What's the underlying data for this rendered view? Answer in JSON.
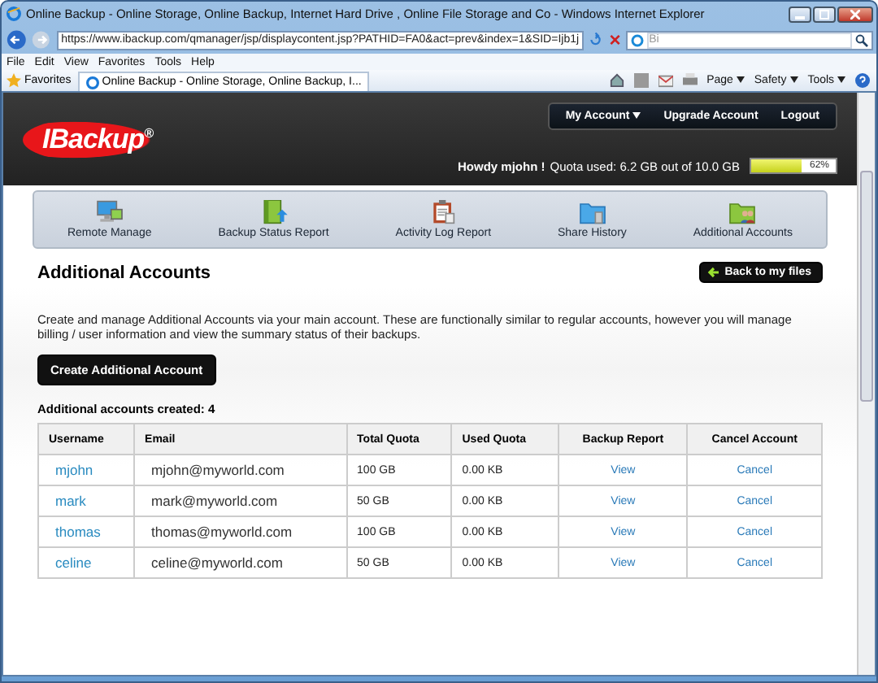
{
  "window": {
    "title": "Online Backup - Online Storage, Online Backup, Internet Hard Drive , Online File Storage and Co - Windows Internet Explorer"
  },
  "address_bar": {
    "url": "https://www.ibackup.com/qmanager/jsp/displaycontent.jsp?PATHID=FA0&act=prev&index=1&SID=Ijb1j",
    "search_placeholder": "Bi"
  },
  "menu": [
    "File",
    "Edit",
    "View",
    "Favorites",
    "Tools",
    "Help"
  ],
  "favorites_bar": {
    "label": "Favorites",
    "tab": "Online Backup - Online Storage, Online Backup, I...",
    "commands": [
      "Page",
      "Safety",
      "Tools"
    ]
  },
  "site_header": {
    "logo": "IBackup$^{®}$",
    "top_nav": [
      {
        "label": "My Account",
        "dropdown": true
      },
      {
        "label": "Upgrade Account",
        "dropdown": false
      },
      {
        "label": "Logout",
        "dropdown": false
      }
    ],
    "greeting": "Howdy mjohn !",
    "quota_text": "Quota used: 6.2 GB out of 10.0 GB",
    "quota": {
      "level": 0.6,
      "reading": "62%"
    }
  },
  "nav": [
    {
      "label": "Remote Manage",
      "kind": "monitor"
    },
    {
      "label": "Backup Status Report",
      "kind": "book"
    },
    {
      "label": "Activity Log Report",
      "kind": "clipboard"
    },
    {
      "label": "Share History",
      "kind": "folder-hand"
    },
    {
      "label": "Additional Accounts",
      "kind": "folder-people"
    }
  ],
  "page": {
    "title": "Additional Accounts",
    "back_button": "Back to my files",
    "description": "Create and manage Additional Accounts via your main account. These are functionally similar to regular accounts, however you will manage billing / user information and view the summary status of their backups.",
    "create_button": "Create Additional Account",
    "count": "Additional accounts created: 4"
  },
  "table": {
    "columns": [
      "Username",
      "Email",
      "Total Quota",
      "Used Quota",
      "Backup Report",
      "Cancel Account"
    ],
    "rows": [
      {
        "username": "mjohn",
        "email": "mjohn@myworld.com",
        "total": "100 GB",
        "used": "0.00 KB",
        "report": "View",
        "cancel": "Cancel"
      },
      {
        "username": "mark",
        "email": "mark@myworld.com",
        "total": "50 GB",
        "used": "0.00 KB",
        "report": "View",
        "cancel": "Cancel"
      },
      {
        "username": "thomas",
        "email": "thomas@myworld.com",
        "total": "100 GB",
        "used": "0.00 KB",
        "report": "View",
        "cancel": "Cancel"
      },
      {
        "username": "celine",
        "email": "celine@myworld.com",
        "total": "50 GB",
        "used": "0.00 KB",
        "report": "View",
        "cancel": "Cancel"
      }
    ]
  }
}
